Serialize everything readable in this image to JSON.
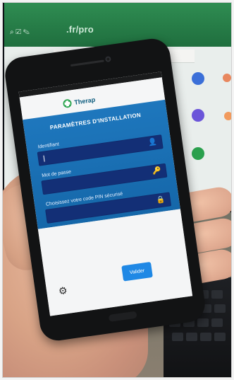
{
  "background_monitor": {
    "url_text": ".fr/pro"
  },
  "phone": {
    "app_name": "Therap",
    "panel_title": "PARAMÈTRES D'INSTALLATION",
    "fields": [
      {
        "label": "Identifiant",
        "placeholder": "",
        "icon": "user-icon"
      },
      {
        "label": "Mot de passe",
        "placeholder": "",
        "icon": "key-icon"
      },
      {
        "label": "Choisissez votre code PIN sécurisé",
        "placeholder": "",
        "icon": "lock-icon"
      }
    ],
    "validate_label": "Valider",
    "settings_icon": "gear-icon"
  }
}
